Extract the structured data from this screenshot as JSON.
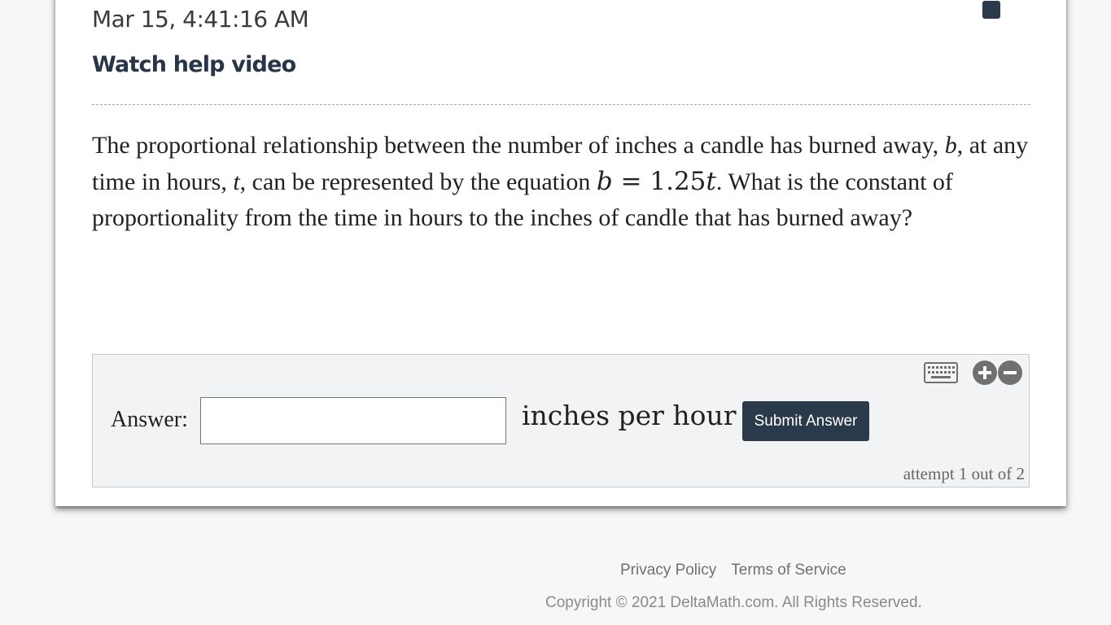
{
  "header": {
    "timestamp": "Mar 15, 4:41:16 AM",
    "help_link": "Watch help video",
    "corner_button_icon": "stop-square-icon"
  },
  "problem": {
    "part1": "The proportional relationship between the number of inches a candle has burned away, ",
    "var_b": "b",
    "part2": ", at any time in hours, ",
    "var_t": "t",
    "part3": ", can be represented by the equation ",
    "equation_lhs": "b",
    "equation_op": " = ",
    "equation_rhs_num": "1.25",
    "equation_rhs_var": "t",
    "part4": ". What is the constant of proportionality from the time in hours to the inches of candle that has burned away?"
  },
  "answer": {
    "label": "Answer:",
    "input_value": "",
    "input_placeholder": "",
    "unit": "inches per hour",
    "submit_label": "Submit Answer",
    "attempt_text": "attempt 1 out of 2",
    "tool_icons": [
      "keyboard-icon",
      "zoom-in-icon",
      "zoom-out-icon"
    ]
  },
  "footer": {
    "privacy": "Privacy Policy",
    "terms": "Terms of Service",
    "copyright": "Copyright © 2021 DeltaMath.com. All Rights Reserved."
  },
  "colors": {
    "accent": "#2b3a4a",
    "card_background": "#ffffff",
    "page_background": "#f6f7f7",
    "answer_panel": "#f2f3f5"
  }
}
